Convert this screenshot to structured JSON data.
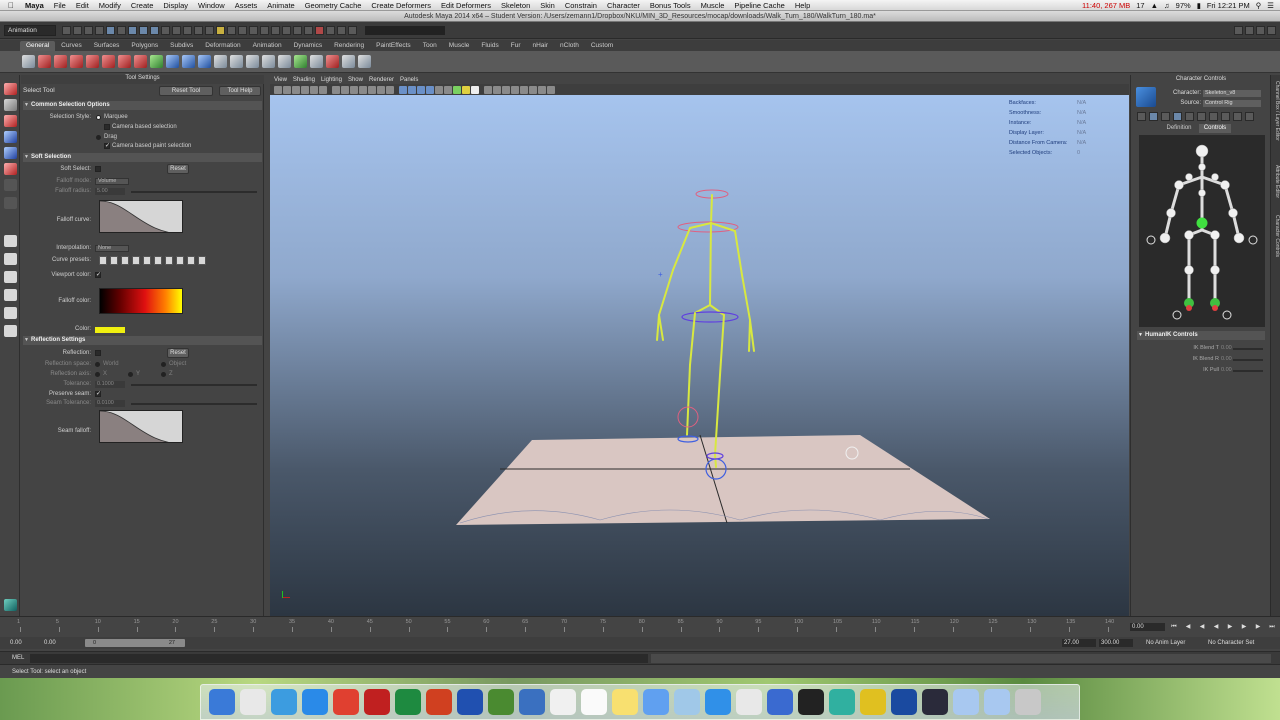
{
  "menubar": {
    "apple": "",
    "items": [
      "Maya",
      "File",
      "Edit",
      "Modify",
      "Create",
      "Display",
      "Window",
      "Assets",
      "Animate",
      "Geometry Cache",
      "Create Deformers",
      "Edit Deformers",
      "Skeleton",
      "Skin",
      "Constrain",
      "Character",
      "Bonus Tools",
      "Muscle",
      "Pipeline Cache",
      "Help"
    ],
    "status_memory": "11:40, 267 MB",
    "status_num": "17",
    "battery": "97%",
    "clock": "Fri 12:21 PM"
  },
  "window_title": "Autodesk Maya 2014 x64 – Student Version: /Users/zemann1/Dropbox/NKU/MIN_3D_Resources/mocap/downloads/Walk_Turn_180/WalkTurn_180.ma*",
  "status_line": {
    "mode": "Animation"
  },
  "shelf": {
    "tabs": [
      "General",
      "Curves",
      "Surfaces",
      "Polygons",
      "Subdivs",
      "Deformation",
      "Animation",
      "Dynamics",
      "Rendering",
      "PaintEffects",
      "Toon",
      "Muscle",
      "Fluids",
      "Fur",
      "nHair",
      "nCloth",
      "Custom"
    ],
    "active_tab": "General"
  },
  "tool_settings": {
    "header": "Tool Settings",
    "tool_name": "Select Tool",
    "reset_button": "Reset Tool",
    "help_button": "Tool Help",
    "common": {
      "title": "Common Selection Options",
      "selection_style_label": "Selection Style:",
      "marquee": "Marquee",
      "camera_based_selection": "Camera based selection",
      "drag": "Drag",
      "camera_based_paint": "Camera based paint selection"
    },
    "soft": {
      "title": "Soft Selection",
      "soft_select_label": "Soft Select:",
      "reset": "Reset",
      "falloff_mode_label": "Falloff mode:",
      "falloff_mode_value": "Volume",
      "falloff_radius_label": "Falloff radius:",
      "falloff_radius_value": "5.00",
      "falloff_curve_label": "Falloff curve:",
      "interpolation_label": "Interpolation:",
      "interpolation_value": "None",
      "curve_presets_label": "Curve presets:",
      "viewport_color_label": "Viewport color:",
      "falloff_color_label": "Falloff color:",
      "color_label": "Color:"
    },
    "reflection": {
      "title": "Reflection Settings",
      "reflection_label": "Reflection:",
      "reset": "Reset",
      "space_label": "Reflection space:",
      "world": "World",
      "object": "Object",
      "axis_label": "Reflection axis:",
      "x": "X",
      "y": "Y",
      "z": "Z",
      "tolerance_label": "Tolerance:",
      "tolerance_value": "0.1000",
      "preserve_seam_label": "Preserve seam:",
      "seam_tolerance_label": "Seam Tolerance:",
      "seam_tolerance_value": "0.0100",
      "seam_falloff_label": "Seam falloff:"
    }
  },
  "viewport": {
    "menus": [
      "View",
      "Shading",
      "Lighting",
      "Show",
      "Renderer",
      "Panels"
    ],
    "hud": [
      {
        "label": "Backfaces:",
        "value": "N/A"
      },
      {
        "label": "Smoothness:",
        "value": "N/A"
      },
      {
        "label": "Instance:",
        "value": "N/A"
      },
      {
        "label": "Display Layer:",
        "value": "N/A"
      },
      {
        "label": "Distance From Camera:",
        "value": "N/A"
      },
      {
        "label": "Selected Objects:",
        "value": "0"
      }
    ]
  },
  "character_controls": {
    "title": "Character Controls",
    "character_label": "Character:",
    "character_value": "Skeleton_v8",
    "source_label": "Source:",
    "source_value": "Control Rig",
    "tabs": [
      "Definition",
      "Controls"
    ],
    "active_tab": "Controls",
    "humanik_title": "HumanIK Controls",
    "ik": [
      {
        "label": "IK Blend T",
        "value": "0.00"
      },
      {
        "label": "IK Blend R",
        "value": "0.00"
      },
      {
        "label": "IK Pull",
        "value": "0.00"
      }
    ]
  },
  "side_tabs": [
    "Channel Box / Layer Editor",
    "Attribute Editor",
    "Character Controls"
  ],
  "time_slider": {
    "ticks": [
      "1",
      "5",
      "10",
      "15",
      "20",
      "25",
      "30",
      "35",
      "40",
      "45",
      "50",
      "55",
      "60",
      "65",
      "70",
      "75",
      "80",
      "85",
      "90",
      "95",
      "100",
      "105",
      "110",
      "115",
      "120",
      "125",
      "130",
      "135",
      "140"
    ],
    "current_frame": "0.00"
  },
  "range_slider": {
    "start": "0.00",
    "inner_start": "0.00",
    "bar_start": "0",
    "bar_end": "27",
    "end": "27.00",
    "max_end": "300.00",
    "anim_layer": "No Anim Layer",
    "character_set": "No Character Set"
  },
  "command_line": {
    "label": "MEL"
  },
  "help_line": {
    "text": "Select Tool: select an object"
  },
  "dock": {
    "icons": [
      "finder",
      "launchpad",
      "mail",
      "safari",
      "chrome",
      "filezilla",
      "excel",
      "powerpoint",
      "word",
      "dreamweaver",
      "xcode",
      "calendar",
      "textedit",
      "notes",
      "itunes",
      "preview",
      "appstore",
      "photos",
      "quicktime",
      "unity",
      "maya",
      "fireworks",
      "photoshop",
      "claquette",
      "folder",
      "downloads",
      "trash"
    ]
  }
}
